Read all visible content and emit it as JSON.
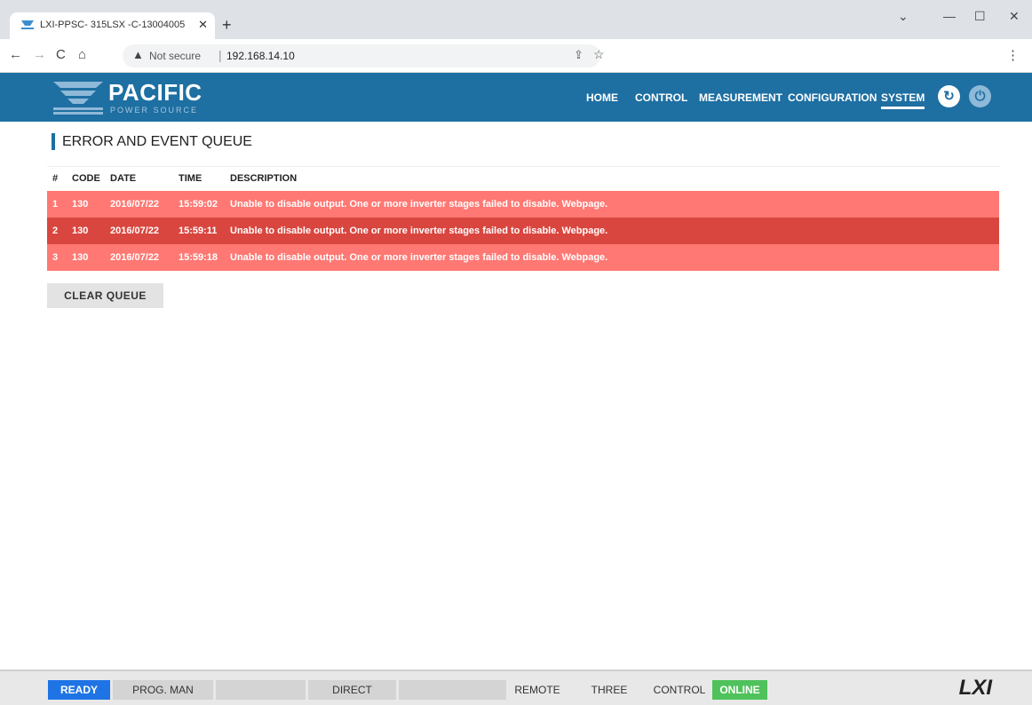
{
  "browser": {
    "tab_title": "LXI-PPSC- 315LSX -C-13004005",
    "security_label": "Not secure",
    "url": "192.168.14.10"
  },
  "header": {
    "logo_name": "PACIFIC",
    "logo_sub": "POWER SOURCE",
    "nav": [
      "HOME",
      "CONTROL",
      "MEASUREMENT",
      "CONFIGURATION",
      "SYSTEM"
    ],
    "active_nav": "SYSTEM"
  },
  "page": {
    "title": "ERROR AND EVENT QUEUE",
    "columns": [
      "#",
      "CODE",
      "DATE",
      "TIME",
      "DESCRIPTION"
    ],
    "rows": [
      {
        "num": "1",
        "code": "130",
        "date": "2016/07/22",
        "time": "15:59:02",
        "description": "Unable to disable output. One or more inverter stages failed to disable. Webpage."
      },
      {
        "num": "2",
        "code": "130",
        "date": "2016/07/22",
        "time": "15:59:11",
        "description": "Unable to disable output. One or more inverter stages failed to disable. Webpage."
      },
      {
        "num": "3",
        "code": "130",
        "date": "2016/07/22",
        "time": "15:59:18",
        "description": "Unable to disable output. One or more inverter stages failed to disable. Webpage."
      }
    ],
    "selected_row": 2,
    "clear_label": "CLEAR QUEUE"
  },
  "status": {
    "ready": "READY",
    "prog": "PROG. MAN",
    "blank1": "",
    "direct": "DIRECT",
    "blank2": "",
    "remote": "REMOTE",
    "phase": "THREE PHASE",
    "control": "CONTROL",
    "online": "ONLINE",
    "logo": "LXI"
  },
  "colors": {
    "header": "#1e6fa2",
    "row_error": "#ff7873",
    "row_selected": "#d9463f",
    "ready": "#1f74e5",
    "online": "#4fc25b"
  }
}
